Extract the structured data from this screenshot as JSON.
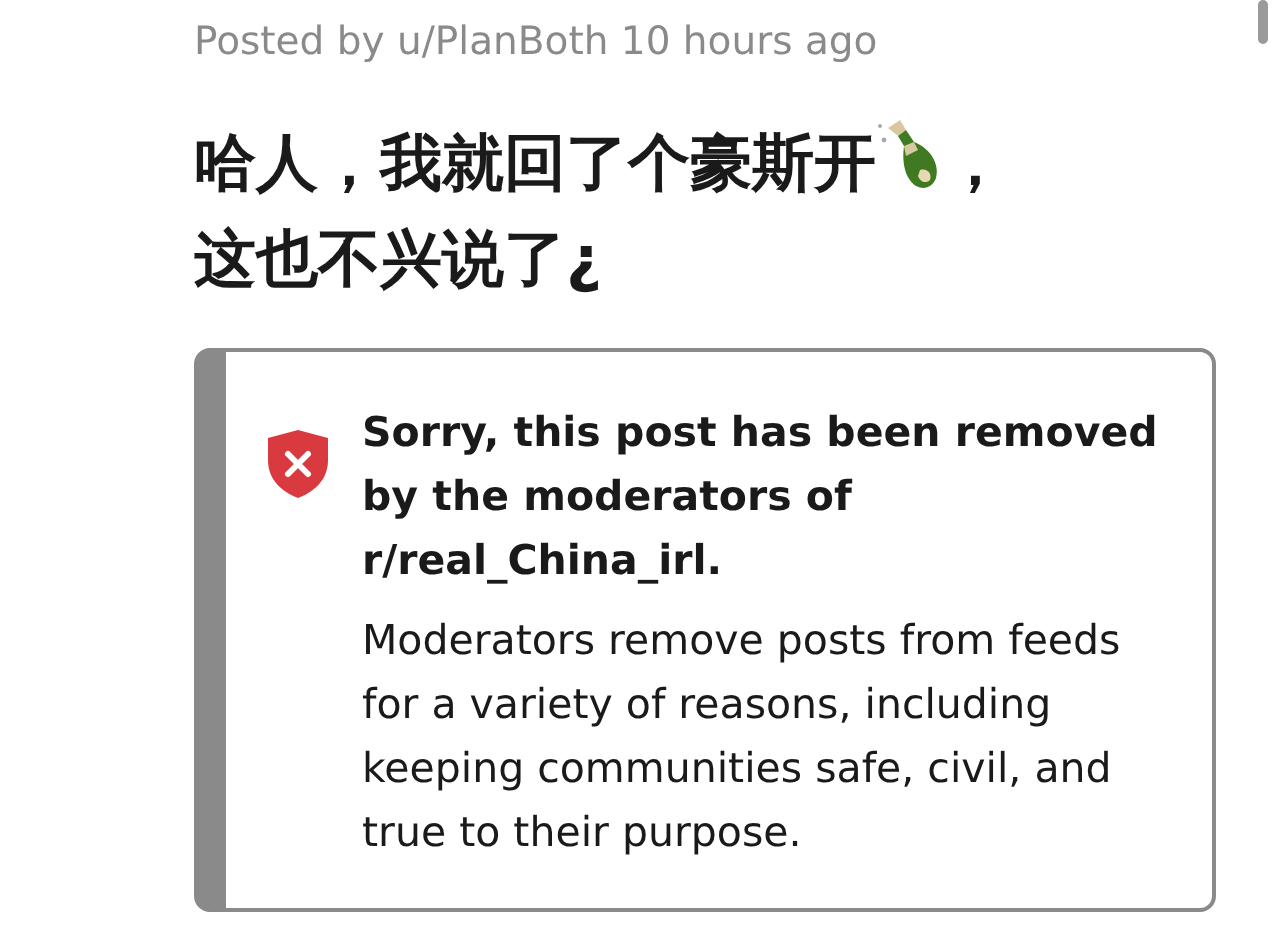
{
  "post": {
    "byline": "Posted by u/PlanBoth 10 hours ago",
    "title_before_emoji": "哈人，我就回了个豪斯开",
    "title_after_emoji": "，",
    "title_second_line": "这也不兴说了¿"
  },
  "notice": {
    "heading": "Sorry, this post has been removed by the moderators of r/real_China_irl.",
    "body": "Moderators remove posts from feeds for a variety of reasons, including keeping communities safe, civil, and true to their purpose."
  }
}
